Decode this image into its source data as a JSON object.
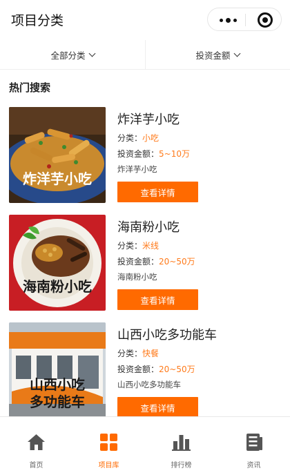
{
  "header": {
    "title": "项目分类"
  },
  "filters": {
    "category_label": "全部分类",
    "investment_label": "投资金额"
  },
  "section": {
    "title": "热门搜索"
  },
  "labels": {
    "category_prefix": "分类：",
    "investment_prefix": "投资金额：",
    "detail_button": "查看详情"
  },
  "projects": [
    {
      "name": "炸洋芋小吃",
      "category": "小吃",
      "investment": "5~10万",
      "desc": "炸洋芋小吃",
      "image_caption": [
        "炸洋芋小吃"
      ],
      "image": "fried-potato-photo"
    },
    {
      "name": "海南粉小吃",
      "category": "米线",
      "investment": "20~50万",
      "desc": "海南粉小吃",
      "image_caption": [
        "海南粉小吃"
      ],
      "image": "hainan-noodle-photo"
    },
    {
      "name": "山西小吃多功能车",
      "category": "快餐",
      "investment": "20~50万",
      "desc": "山西小吃多功能车",
      "image_caption": [
        "山西小吃",
        "多功能车"
      ],
      "image": "food-truck-photo"
    }
  ],
  "tabbar": {
    "items": [
      {
        "label": "首页",
        "icon": "home-icon",
        "active": false
      },
      {
        "label": "项目库",
        "icon": "grid-icon",
        "active": true
      },
      {
        "label": "排行榜",
        "icon": "bar-chart-icon",
        "active": false
      },
      {
        "label": "资讯",
        "icon": "news-icon",
        "active": false
      }
    ]
  },
  "colors": {
    "accent": "#ff6a00",
    "value_text": "#ff7a1a",
    "tab_inactive": "#555555"
  }
}
